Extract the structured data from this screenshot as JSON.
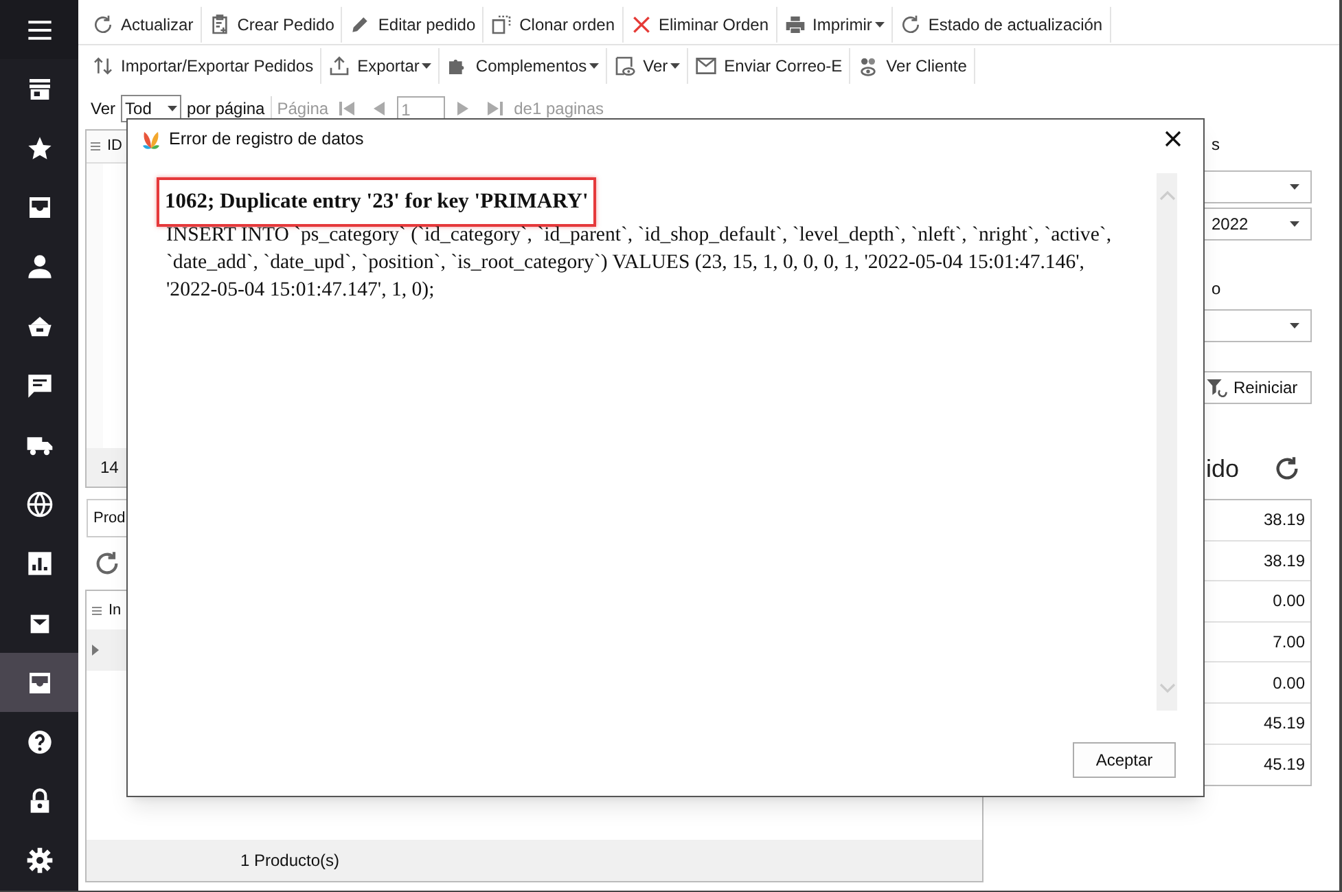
{
  "sidebar": {
    "items": [
      {
        "selected": false
      },
      {
        "selected": false
      },
      {
        "selected": false
      },
      {
        "selected": false
      },
      {
        "selected": false
      },
      {
        "selected": false
      },
      {
        "selected": false
      },
      {
        "selected": false
      },
      {
        "selected": false
      },
      {
        "selected": false
      },
      {
        "selected": false
      },
      {
        "selected": true
      },
      {
        "selected": false
      },
      {
        "selected": false
      },
      {
        "selected": false
      }
    ]
  },
  "toolbar": {
    "rows": [
      {
        "buttons": [
          {
            "label": "Actualizar",
            "dropdown": false
          },
          {
            "label": "Crear Pedido",
            "dropdown": false
          },
          {
            "label": "Editar pedido",
            "dropdown": false
          },
          {
            "label": "Clonar orden",
            "dropdown": false
          },
          {
            "label": "Eliminar Orden",
            "dropdown": false
          },
          {
            "label": "Imprimir",
            "dropdown": true
          },
          {
            "label": "Estado de actualización",
            "dropdown": false
          }
        ]
      },
      {
        "buttons": [
          {
            "label": "Importar/Exportar Pedidos",
            "dropdown": false
          },
          {
            "label": "Exportar",
            "dropdown": true
          },
          {
            "label": "Complementos",
            "dropdown": true
          },
          {
            "label": "Ver",
            "dropdown": true
          },
          {
            "label": "Enviar Correo-E",
            "dropdown": false
          },
          {
            "label": "Ver Cliente",
            "dropdown": false
          }
        ]
      }
    ]
  },
  "pager": {
    "show_label": "Ver",
    "per_page": "Tod",
    "per_page_suffix": "por página",
    "page_label": "Página",
    "page": "1",
    "page_total": "de1 paginas"
  },
  "orders_grid": {
    "column_1": "ID",
    "footer": "14"
  },
  "detail_tabs": [
    {
      "label": "Prod",
      "selected": true
    }
  ],
  "products_grid": {
    "column_1": "In",
    "footer": "1 Producto(s)"
  },
  "filters": {
    "label_1": "s",
    "date_value": "2022",
    "label_2": "o",
    "reset_button": "Reiniciar"
  },
  "summary": {
    "title": "ido",
    "values": [
      "38.19",
      "38.19",
      "0.00",
      "7.00",
      "0.00",
      "45.19",
      "45.19"
    ]
  },
  "dialog": {
    "title": "Error de registro de datos",
    "error_heading": "1062; Duplicate entry '23' for key 'PRIMARY'",
    "message": "INSERT INTO `ps_category` (`id_category`, `id_parent`, `id_shop_default`, `level_depth`, `nleft`, `nright`, `active`, `date_add`, `date_upd`, `position`, `is_root_category`) VALUES (23, 15, 1, 0, 0, 0, 1, '2022-05-04 15:01:47.146', '2022-05-04 15:01:47.147', 1, 0);",
    "ok_button": "Aceptar"
  }
}
